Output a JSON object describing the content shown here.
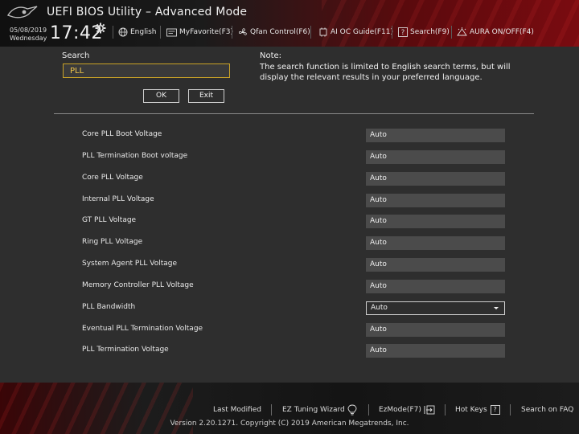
{
  "header": {
    "title": "UEFI BIOS Utility – Advanced Mode",
    "date": "05/08/2019",
    "weekday": "Wednesday",
    "time": "17:42",
    "menu": [
      {
        "label": "English",
        "icon": "globe-icon"
      },
      {
        "label": "MyFavorite(F3)",
        "icon": "favorite-icon"
      },
      {
        "label": "Qfan Control(F6)",
        "icon": "fan-icon"
      },
      {
        "label": "AI OC Guide(F11)",
        "icon": "ai-oc-icon"
      },
      {
        "label": "Search(F9)",
        "icon": "question-icon"
      },
      {
        "label": "AURA ON/OFF(F4)",
        "icon": "aura-icon"
      }
    ]
  },
  "search": {
    "label": "Search",
    "value": "PLL",
    "ok_label": "OK",
    "exit_label": "Exit",
    "note_title": "Note:",
    "note_text": "The search function is limited to English search terms, but will display the relevant results in your preferred language."
  },
  "results": [
    {
      "label": "Core PLL Boot Voltage",
      "value": "Auto"
    },
    {
      "label": "PLL Termination Boot voltage",
      "value": "Auto"
    },
    {
      "label": "Core PLL Voltage",
      "value": "Auto"
    },
    {
      "label": "Internal PLL Voltage",
      "value": "Auto"
    },
    {
      "label": "GT PLL Voltage",
      "value": "Auto"
    },
    {
      "label": "Ring PLL Voltage",
      "value": "Auto"
    },
    {
      "label": "System Agent PLL Voltage",
      "value": "Auto"
    },
    {
      "label": "Memory Controller PLL Voltage",
      "value": "Auto"
    },
    {
      "label": "PLL Bandwidth",
      "value": "Auto"
    },
    {
      "label": "Eventual PLL Termination Voltage",
      "value": "Auto"
    },
    {
      "label": "PLL Termination Voltage",
      "value": "Auto"
    }
  ],
  "footer": {
    "last_modified": "Last Modified",
    "ez_tuning": "EZ Tuning Wizard",
    "ez_mode": "EzMode(F7)",
    "hot_keys": "Hot Keys",
    "hot_keys_key": "?",
    "search_faq": "Search on FAQ",
    "copyright": "Version 2.20.1271. Copyright (C) 2019 American Megatrends, Inc."
  },
  "colors": {
    "accent_red": "#7a0b10",
    "search_border": "#c9a227",
    "search_text": "#f2c84a",
    "value_box": "#4b4b4b",
    "background": "#2e2e2e"
  }
}
